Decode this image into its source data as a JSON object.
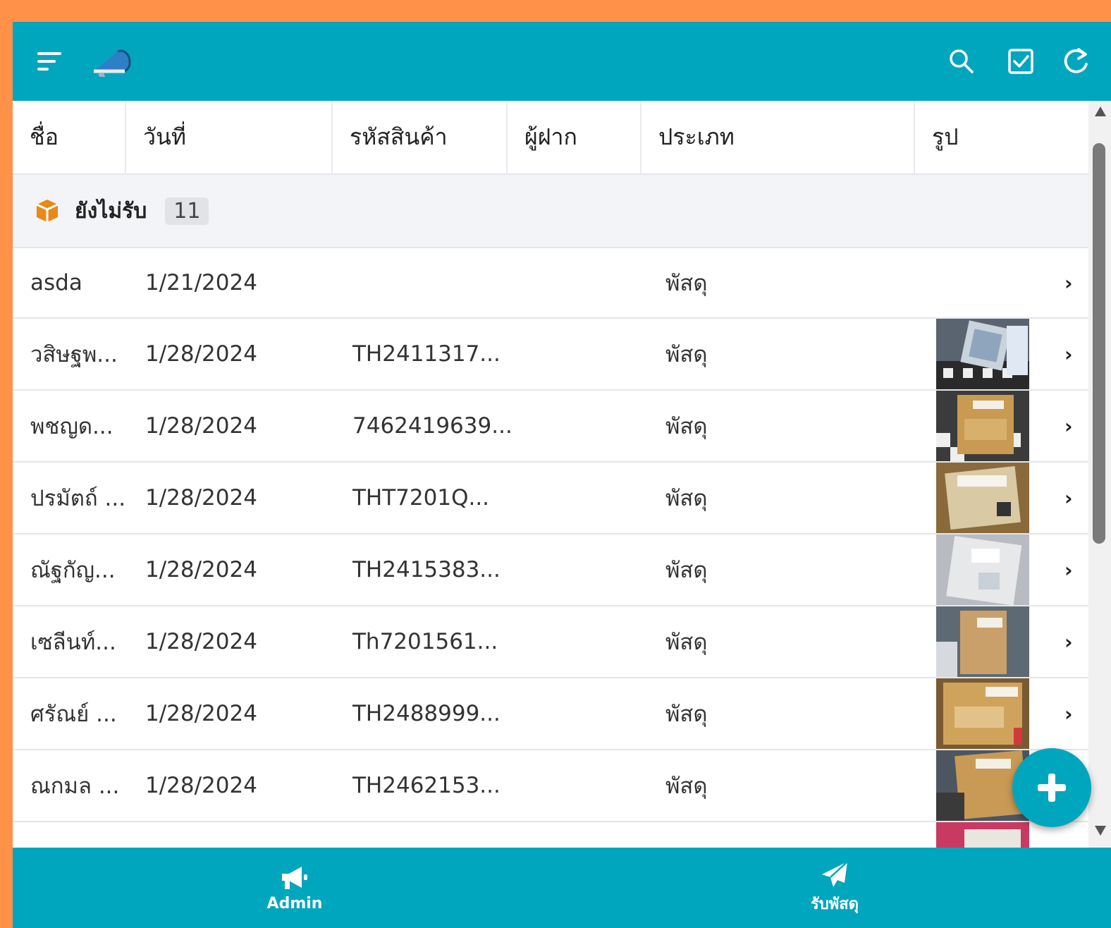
{
  "colors": {
    "primary": "#00a6bd",
    "background": "#ff9148",
    "accent_icon": "#e8891a"
  },
  "topbar": {
    "icons": [
      "filter-lines-icon",
      "megaphone-logo-icon",
      "search-icon",
      "checkbox-icon",
      "refresh-icon"
    ]
  },
  "table": {
    "columns": [
      "ชื่อ",
      "วันที่",
      "รหัสสินค้า",
      "ผู้ฝาก",
      "ประเภท",
      "รูป"
    ],
    "group": {
      "icon": "package-icon",
      "label": "ยังไม่รับ",
      "count": "11"
    },
    "rows": [
      {
        "name": "asda",
        "date": "1/21/2024",
        "code": "",
        "depositor": "",
        "type": "พัสดุ",
        "has_image": false
      },
      {
        "name": "วสิษฐพ...",
        "date": "1/28/2024",
        "code": "TH2411317...",
        "depositor": "",
        "type": "พัสดุ",
        "has_image": true
      },
      {
        "name": "พชญด...",
        "date": "1/28/2024",
        "code": "7462419639...",
        "depositor": "",
        "type": "พัสดุ",
        "has_image": true
      },
      {
        "name": "ปรมัตถ์ ...",
        "date": "1/28/2024",
        "code": "THT7201Q...",
        "depositor": "",
        "type": "พัสดุ",
        "has_image": true
      },
      {
        "name": "ณัฐกัญ...",
        "date": "1/28/2024",
        "code": "TH2415383...",
        "depositor": "",
        "type": "พัสดุ",
        "has_image": true
      },
      {
        "name": "เซลีนท์...",
        "date": "1/28/2024",
        "code": "Th7201561...",
        "depositor": "",
        "type": "พัสดุ",
        "has_image": true
      },
      {
        "name": "ศรัณย์ ...",
        "date": "1/28/2024",
        "code": "TH2488999...",
        "depositor": "",
        "type": "พัสดุ",
        "has_image": true
      },
      {
        "name": "ณกมล ...",
        "date": "1/28/2024",
        "code": "TH2462153...",
        "depositor": "",
        "type": "พัสดุ",
        "has_image": true
      },
      {
        "name": "",
        "date": "",
        "code": "",
        "depositor": "",
        "type": "",
        "has_image": true
      }
    ]
  },
  "fab": {
    "icon": "plus-icon"
  },
  "bottom_nav": [
    {
      "label": "Admin",
      "icon": "megaphone-icon"
    },
    {
      "label": "รับพัสดุ",
      "icon": "paper-plane-icon"
    }
  ]
}
